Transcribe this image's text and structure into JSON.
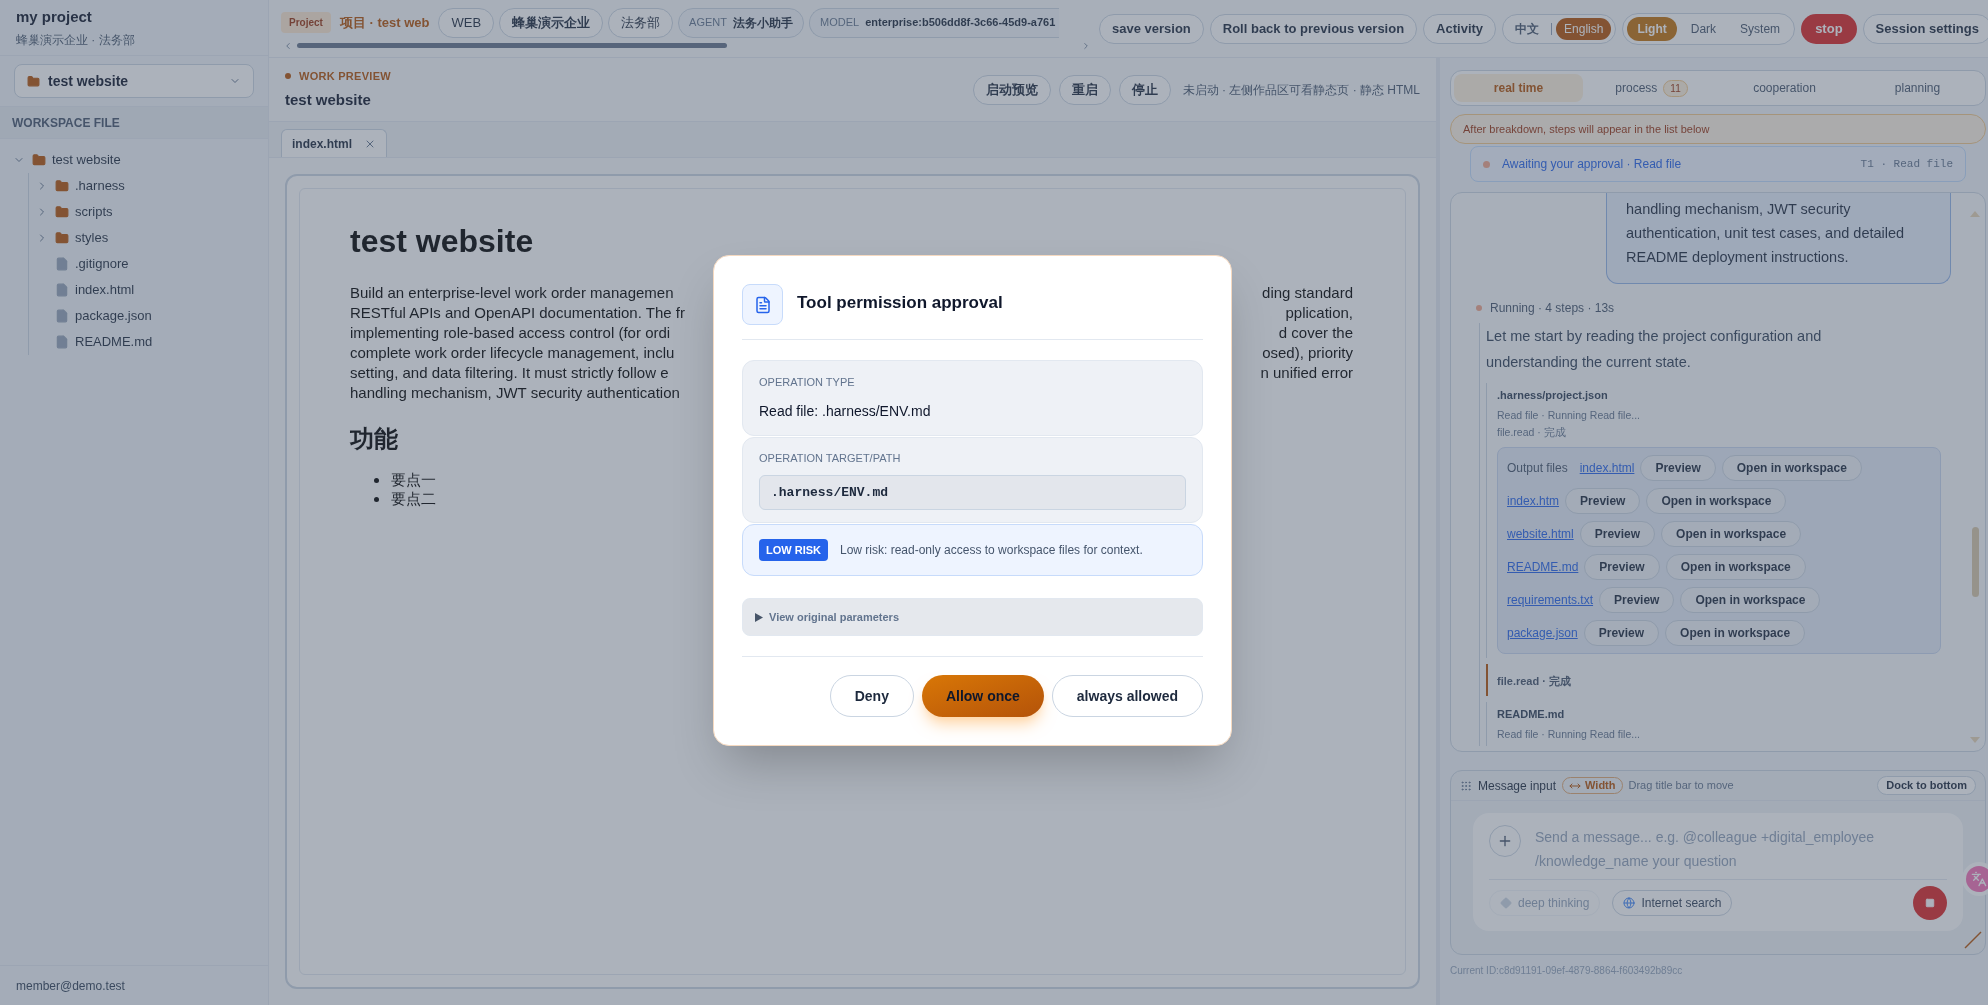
{
  "sidebar": {
    "project_title": "my project",
    "project_subtitle": "蜂巢演示企业 · 法务部",
    "workspace_select": "test website",
    "section_title": "WORKSPACE FILE",
    "tree": [
      {
        "label": "test website",
        "kind": "folder",
        "expanded": true,
        "children": [
          {
            "label": ".harness",
            "kind": "folder",
            "expanded": false
          },
          {
            "label": "scripts",
            "kind": "folder",
            "expanded": false
          },
          {
            "label": "styles",
            "kind": "folder",
            "expanded": false
          },
          {
            "label": ".gitignore",
            "kind": "file"
          },
          {
            "label": "index.html",
            "kind": "file"
          },
          {
            "label": "package.json",
            "kind": "file"
          },
          {
            "label": "README.md",
            "kind": "file"
          }
        ]
      }
    ],
    "footer_user": "member@demo.test"
  },
  "topbar": {
    "project_badge": "Project",
    "project_name": "项目 · test web",
    "type_chip": "WEB",
    "context_chips": [
      {
        "label": "蜂巢演示企业",
        "selected": true
      },
      {
        "label": "法务部",
        "selected": false
      }
    ],
    "agent": {
      "label": "AGENT",
      "value": "法务小助手"
    },
    "model": {
      "label": "MODEL",
      "value": "enterprise:b506dd8f-3c66-45d9-a761"
    },
    "actions": [
      "save version",
      "Roll back to previous version",
      "Activity"
    ],
    "languages": [
      {
        "label": "中文",
        "selected": false
      },
      {
        "label": "English",
        "selected": true
      }
    ],
    "themes": [
      {
        "label": "Light",
        "selected": true
      },
      {
        "label": "Dark",
        "selected": false
      },
      {
        "label": "System",
        "selected": false
      }
    ],
    "stop": "stop",
    "settings": "Session settings"
  },
  "preview": {
    "eyebrow": "WORK PREVIEW",
    "title": "test website",
    "buttons": [
      "启动预览",
      "重启",
      "停止"
    ],
    "status": "未启动 · 左侧作品区可看静态页 · 静态 HTML",
    "tabs": [
      {
        "label": "index.html",
        "selected": true
      }
    ],
    "document": {
      "heading": "test website",
      "paragraph_lines": [
        {
          "left": "Build an enterprise-level work order managemen",
          "right": "ding standard"
        },
        {
          "left": "RESTful APIs and OpenAPI documentation. The fr",
          "right": "pplication,"
        },
        {
          "left": "implementing role-based access control (for ordi",
          "right": "d cover the"
        },
        {
          "left": "complete work order lifecycle management, inclu",
          "right": "osed), priority"
        },
        {
          "left": "setting, and data filtering. It must strictly follow e",
          "right": "n unified error"
        },
        {
          "left": "handling mechanism, JWT security authentication"
        }
      ],
      "subheading": "功能",
      "bullets": [
        "要点一",
        "要点二"
      ]
    }
  },
  "right_panel": {
    "tabs": [
      {
        "label": "real time",
        "selected": true
      },
      {
        "label": "process",
        "count": "11",
        "selected": false
      },
      {
        "label": "cooperation",
        "selected": false
      },
      {
        "label": "planning",
        "selected": false
      }
    ],
    "banner": "After breakdown, steps will appear in the list below",
    "approval": {
      "text": "Awaiting your approval · Read file",
      "tag": "T1 · Read file"
    },
    "chat": {
      "user_message": "handling mechanism, JWT security authentication, unit test cases, and detailed README deployment instructions.",
      "run_status": "Running · 4 steps · 13s",
      "assistant_text": "Let me start by reading the project configuration and understanding the current state.",
      "items": [
        {
          "kind": "step",
          "path": ".harness/project.json",
          "detail": "Read file · Running Read file...",
          "result": "file.read · 完成",
          "output_label": "Output files",
          "output_files": [
            {
              "name": "index.html",
              "preview": "Preview",
              "open": "Open in workspace"
            },
            {
              "name": "index.htm",
              "preview": "Preview",
              "open": "Open in workspace"
            },
            {
              "name": "website.html",
              "preview": "Preview",
              "open": "Open in workspace"
            },
            {
              "name": "README.md",
              "preview": "Preview",
              "open": "Open in workspace"
            },
            {
              "name": "requirements.txt",
              "preview": "Preview",
              "open": "Open in workspace"
            },
            {
              "name": "package.json",
              "preview": "Preview",
              "open": "Open in workspace"
            }
          ]
        },
        {
          "kind": "status",
          "text": "file.read · 完成"
        },
        {
          "kind": "step",
          "path": "README.md",
          "detail": "Read file · Running Read file..."
        }
      ]
    },
    "message_input": {
      "title": "Message input",
      "width_chip": "Width",
      "hint": "Drag title bar to move",
      "dock": "Dock to bottom",
      "placeholder": "Send a message... e.g. @colleague +digital_employee /knowledge_name your question",
      "toggles": [
        {
          "label": "deep thinking",
          "disabled": true,
          "kind": "diamond"
        },
        {
          "label": "Internet search",
          "disabled": false,
          "kind": "globe"
        }
      ]
    },
    "current_id": "Current ID:c8d91191-09ef-4879-8864-f603492b89cc"
  },
  "modal": {
    "title": "Tool permission approval",
    "operation_type_label": "OPERATION TYPE",
    "operation_type": "Read file: .harness/ENV.md",
    "target_label": "OPERATION TARGET/PATH",
    "target": ".harness/ENV.md",
    "risk_badge": "LOW RISK",
    "risk_text": "Low risk: read-only access to workspace files for context.",
    "params_toggle": "View original parameters",
    "params_expanded": false,
    "buttons": [
      {
        "label": "Deny",
        "kind": "plain"
      },
      {
        "label": "Allow once",
        "kind": "primary"
      },
      {
        "label": "always allowed",
        "kind": "plain"
      }
    ]
  }
}
